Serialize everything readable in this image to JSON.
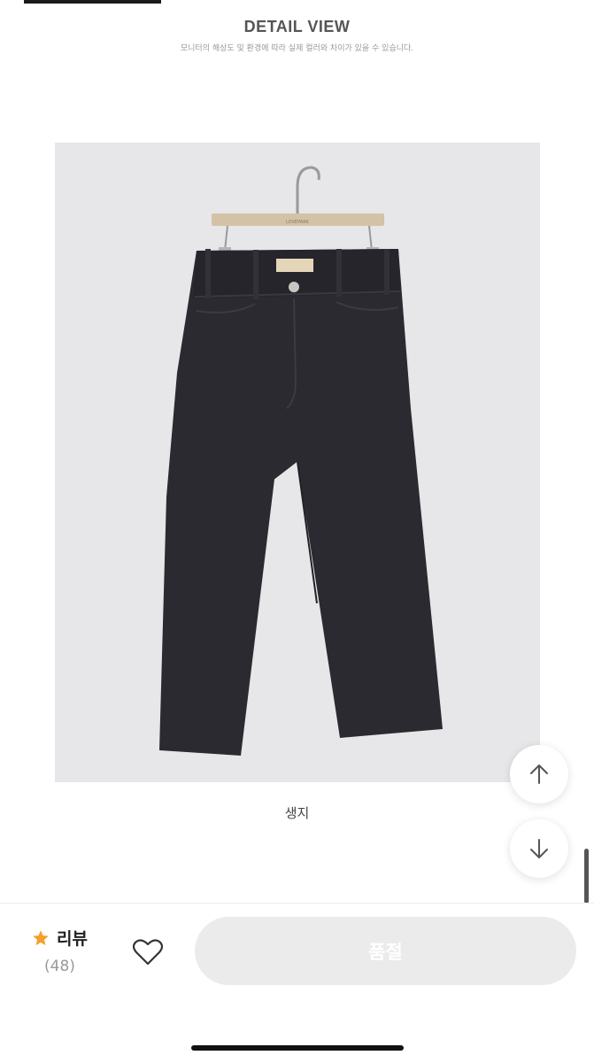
{
  "detail": {
    "title": "DETAIL VIEW",
    "subtitle": "모니터의 해상도 및 환경에 따라 실제 컬러와 차이가 있을 수 있습니다."
  },
  "photo": {
    "caption": "생지",
    "label_text": "LOVEPARK"
  },
  "scroll": {
    "up_icon": "arrow-up-icon",
    "down_icon": "arrow-down-icon"
  },
  "bottom_bar": {
    "review_label": "리뷰",
    "review_count": "(48)",
    "wish_icon": "heart-icon",
    "buy_button_label": "품절"
  },
  "colors": {
    "star": "#f4a02e",
    "denim": "#2b2a30",
    "photo_bg": "#e7e6e8",
    "soldout_bg": "#ebebeb"
  }
}
